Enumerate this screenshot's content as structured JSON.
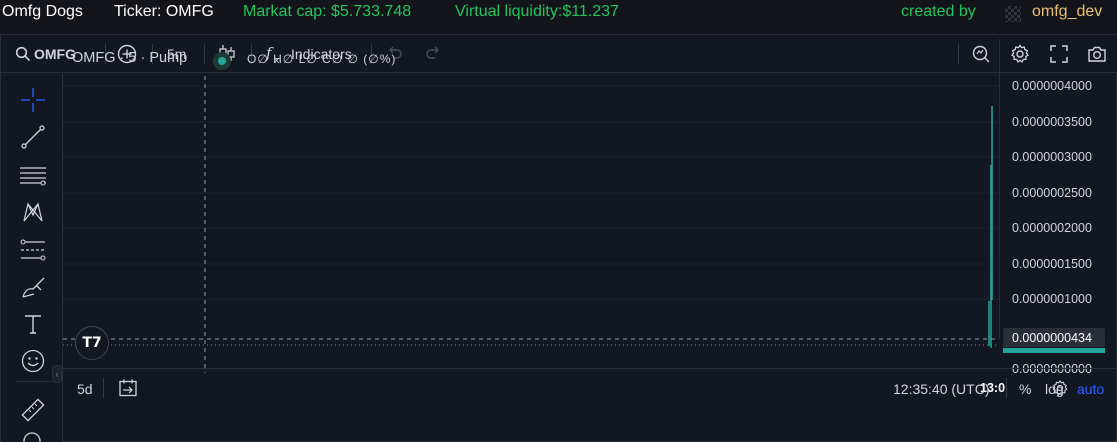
{
  "header": {
    "token_name": "Omfg Dogs",
    "ticker": "Ticker: OMFG",
    "market_cap": "Markat cap: $5.733.748",
    "virtual_liquidity": "Virtual liquidity:$11.237",
    "created_by_label": "created by",
    "creator": "omfg_dev",
    "accent_green": "#22c55e",
    "creator_color": "#e8c170"
  },
  "toolbar": {
    "symbol": "OMFG",
    "interval": "5m",
    "indicators_label": "Indicators",
    "icons": [
      "search-icon",
      "add-compare-icon",
      "candles-icon",
      "fx-icon",
      "undo-icon",
      "redo-icon",
      "screener-icon",
      "settings-icon",
      "fullscreen-icon",
      "camera-icon"
    ]
  },
  "left_tools": [
    "crosshair-icon",
    "trendline-icon",
    "fib-lines-icon",
    "pattern-icon",
    "prediction-icon",
    "brush-icon",
    "text-icon",
    "emoji-icon",
    "ruler-icon",
    "zoom-icon"
  ],
  "legend": {
    "title": "OMFG · 5 · Pump",
    "ohlc": "O∅ H∅ L∅ C∅ ∅ (∅%)"
  },
  "price_scale": {
    "ticks": [
      "0.0000004000",
      "0.0000003500",
      "0.0000003000",
      "0.0000002500",
      "0.0000002000",
      "0.0000001500",
      "0.0000001000",
      "0.0000000434",
      "0.0000000000"
    ],
    "current_price": "0.0000000434",
    "time_label": "13:0"
  },
  "bottom_bar": {
    "range": "5d",
    "clock": "12:35:40 (UTC)",
    "percent": "%",
    "log": "log",
    "auto": "auto"
  },
  "logo": "T7",
  "colors": {
    "background": "#131722",
    "up": "#26a69a",
    "auto_blue": "#2962ff"
  }
}
